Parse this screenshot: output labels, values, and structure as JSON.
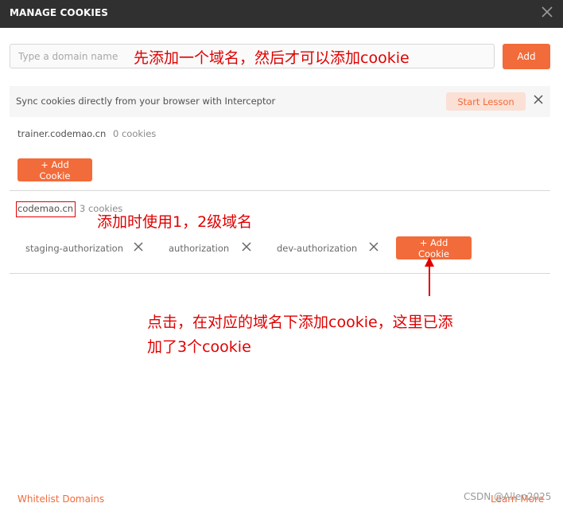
{
  "window": {
    "title": "MANAGE COOKIES"
  },
  "domain_form": {
    "placeholder": "Type a domain name",
    "add_label": "Add"
  },
  "banner": {
    "text": "Sync cookies directly from your browser with Interceptor",
    "button_label": "Start Lesson"
  },
  "domains": [
    {
      "name": "trainer.codemao.cn",
      "count": "0 cookies",
      "add_label": "+ Add Cookie",
      "cookies": []
    },
    {
      "name": "codemao.cn",
      "count": "3 cookies",
      "add_label": "+ Add Cookie",
      "cookies": [
        "staging-authorization",
        "authorization",
        "dev-authorization"
      ]
    }
  ],
  "annotations": {
    "top": "先添加一个域名，然后才可以添加cookie",
    "middle": "添加时使用1，2级域名",
    "bottom_line1": "点击，在对应的域名下添加cookie，这里已添",
    "bottom_line2": "加了3个cookie"
  },
  "footer": {
    "whitelist": "Whitelist Domains",
    "learn_more": "Learn More",
    "watermark": "CSDN @Allen2025"
  },
  "colors": {
    "accent": "#f26b3a",
    "titlebar": "#303030",
    "annotation": "#e00000"
  }
}
